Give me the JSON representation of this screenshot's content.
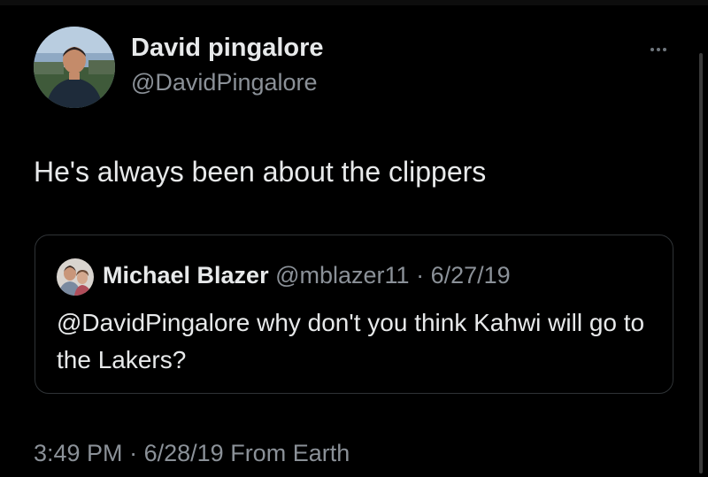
{
  "author": {
    "name": "David pingalore",
    "handle": "@DavidPingalore",
    "avatar_icon": "person-avatar-photo"
  },
  "more_icon": "ellipsis-icon",
  "tweet": {
    "text": "He's always been about the clippers"
  },
  "quoted_tweet": {
    "name": "Michael Blazer",
    "handle": "@mblazer11",
    "separator": "·",
    "date": "6/27/19",
    "text": "@DavidPingalore why don't you think Kahwi will go to the Lakers?",
    "avatar_icon": "person-avatar-photo"
  },
  "meta": {
    "time": "3:49 PM",
    "separator": "·",
    "date": "6/28/19",
    "source": "From Earth"
  },
  "colors": {
    "background": "#000000",
    "primary_text": "#e7e9ea",
    "secondary_text": "#8b9198",
    "border": "#2f3336"
  }
}
